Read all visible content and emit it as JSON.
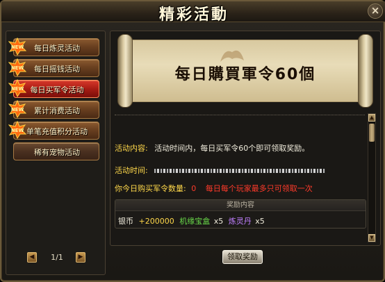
{
  "window": {
    "title": "精彩活動",
    "close_label": "×"
  },
  "sidebar": {
    "items": [
      {
        "label": "每日炼灵活动",
        "new": true,
        "selected": false
      },
      {
        "label": "每日摇钱活动",
        "new": true,
        "selected": false
      },
      {
        "label": "每日买军令活动",
        "new": true,
        "selected": true
      },
      {
        "label": "累计消费活动",
        "new": true,
        "selected": false
      },
      {
        "label": "单笔充值积分活动",
        "new": true,
        "selected": false
      },
      {
        "label": "稀有宠物活动",
        "new": false,
        "selected": false
      }
    ],
    "badge_text": "NEW",
    "pager": {
      "prev_icon": "◀",
      "next_icon": "▶",
      "text": "1/1"
    }
  },
  "main": {
    "banner_title": "每日購買軍令60個",
    "content_label": "活动内容:",
    "content_value": "活动时间内，每日买军令60个即可领取奖励。",
    "time_label": "活动时间:",
    "bought_label": "你今日购买军令数量:",
    "bought_count": "0",
    "bought_note": "每日每个玩家最多只可领取一次",
    "reward": {
      "header": "奖励内容",
      "items": [
        {
          "name": "银币",
          "amount": "+200000"
        },
        {
          "name": "机缘宝盒",
          "amount": "x5"
        },
        {
          "name": "炼灵丹",
          "amount": "x5"
        }
      ]
    },
    "claim_button": "领取奖励"
  },
  "colors": {
    "selected_tab": "#c02218",
    "label_yellow": "#ffd84a",
    "reward_green": "#6adc4a",
    "reward_purple": "#c080ff",
    "alert_red": "#ff3a2a"
  }
}
